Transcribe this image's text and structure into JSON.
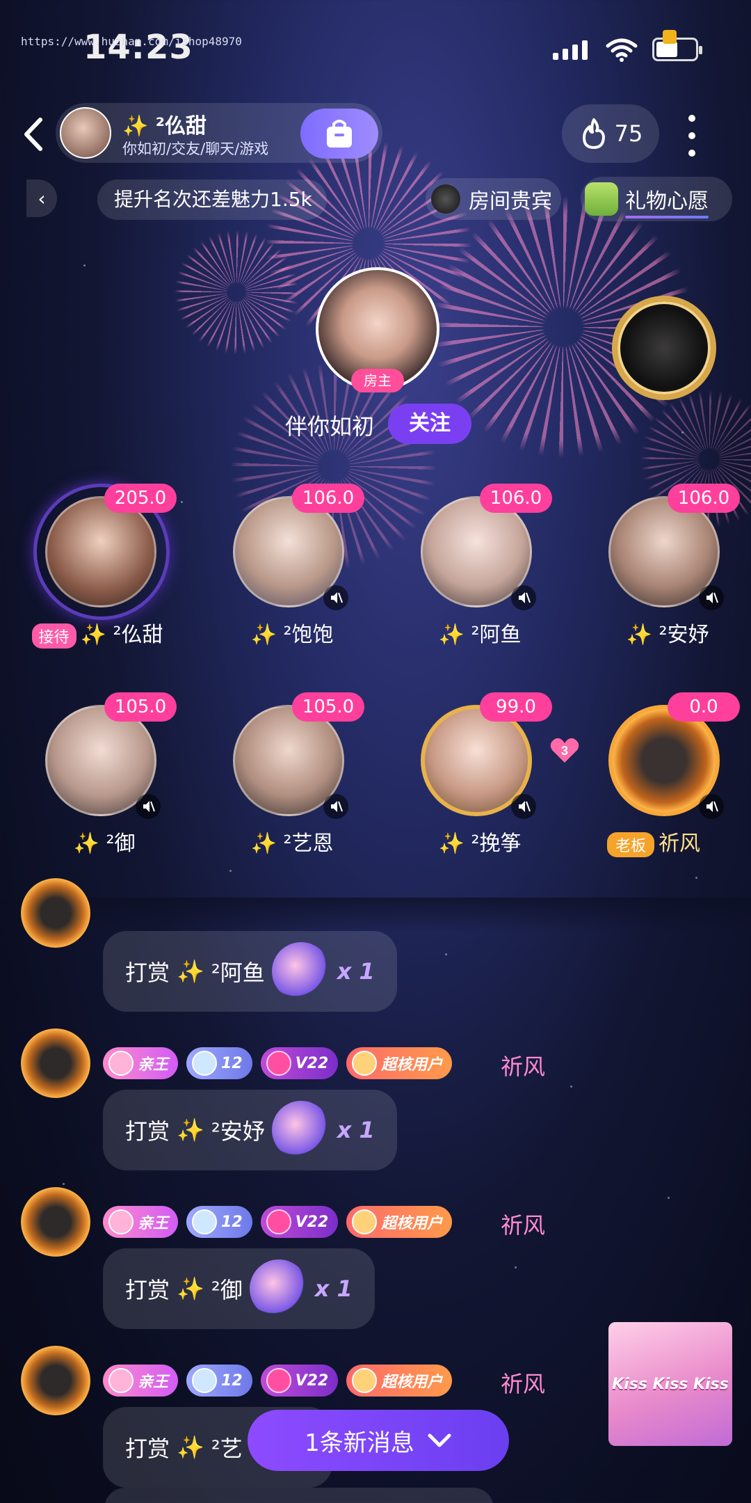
{
  "status_bar": {
    "watermark": "https://www.huzhan.com/ishop48970",
    "time": "14:23"
  },
  "header": {
    "room_title": "✨ ²仫甜",
    "room_subtitle": "你如初/交友/聊天/游戏",
    "heat_value": "75"
  },
  "ticker": {
    "back_arrow": "‹",
    "text": "提升名次还差魅力1.5k",
    "vip_label": "房间贵宾",
    "gift_wish_label": "礼物心愿"
  },
  "host": {
    "tag": "房主",
    "name": "伴你如初",
    "follow_label": "关注"
  },
  "seats": [
    {
      "name": "²仫甜",
      "score": "205.0",
      "tag": "接待",
      "accent": "#ff5aa8"
    },
    {
      "name": "²饱饱",
      "score": "106.0"
    },
    {
      "name": "²阿鱼",
      "score": "106.0"
    },
    {
      "name": "²安妤",
      "score": "106.0"
    },
    {
      "name": "²御",
      "score": "105.0"
    },
    {
      "name": "²艺恩",
      "score": "105.0"
    },
    {
      "name": "²挽筝",
      "score": "99.0"
    },
    {
      "name": "祈风",
      "score": "0.0",
      "tag": "老板"
    }
  ],
  "pair_heart_count": "3",
  "chat": {
    "reward_word": "打赏",
    "sparkle": "✨",
    "badges": {
      "king": "亲王",
      "level": "12",
      "vip": "V22",
      "super": "超核用户"
    },
    "messages": [
      {
        "sender": "祈风",
        "target": "²阿鱼",
        "count": "x 1"
      },
      {
        "sender": "祈风",
        "target": "²安妤",
        "count": "x 1"
      },
      {
        "sender": "祈风",
        "target": "²御",
        "count": "x 1"
      },
      {
        "sender": "祈风",
        "target": "²艺"
      }
    ],
    "new_message_label": "1条新消息"
  },
  "promo_banner": "Kiss Kiss Kiss"
}
